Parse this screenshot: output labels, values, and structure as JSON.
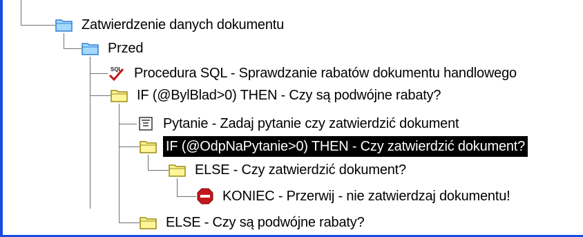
{
  "tree": {
    "nodes": [
      {
        "label": "Zatwierdzenie danych dokumentu",
        "icon": "folder-open-blue-icon"
      },
      {
        "label": "Przed",
        "icon": "folder-open-blue-icon"
      },
      {
        "label": "Procedura SQL - Sprawdzanie rabatów dokumentu handlowego",
        "icon": "sql-check-icon"
      },
      {
        "label": "IF (@BylBlad>0) THEN - Czy są podwójne rabaty?",
        "icon": "folder-yellow-icon"
      },
      {
        "label": "Pytanie - Zadaj pytanie czy zatwierdzić dokument",
        "icon": "question-list-icon"
      },
      {
        "label": "IF (@OdpNaPytanie>0) THEN - Czy zatwierdzić dokument?",
        "icon": "folder-yellow-icon",
        "selected": true
      },
      {
        "label": "ELSE - Czy zatwierdzić dokument?",
        "icon": "folder-yellow-icon"
      },
      {
        "label": "KONIEC - Przerwij - nie zatwierdzaj dokumentu!",
        "icon": "stop-sign-icon"
      },
      {
        "label": "ELSE - Czy są podwójne rabaty?",
        "icon": "folder-yellow-icon"
      }
    ]
  }
}
